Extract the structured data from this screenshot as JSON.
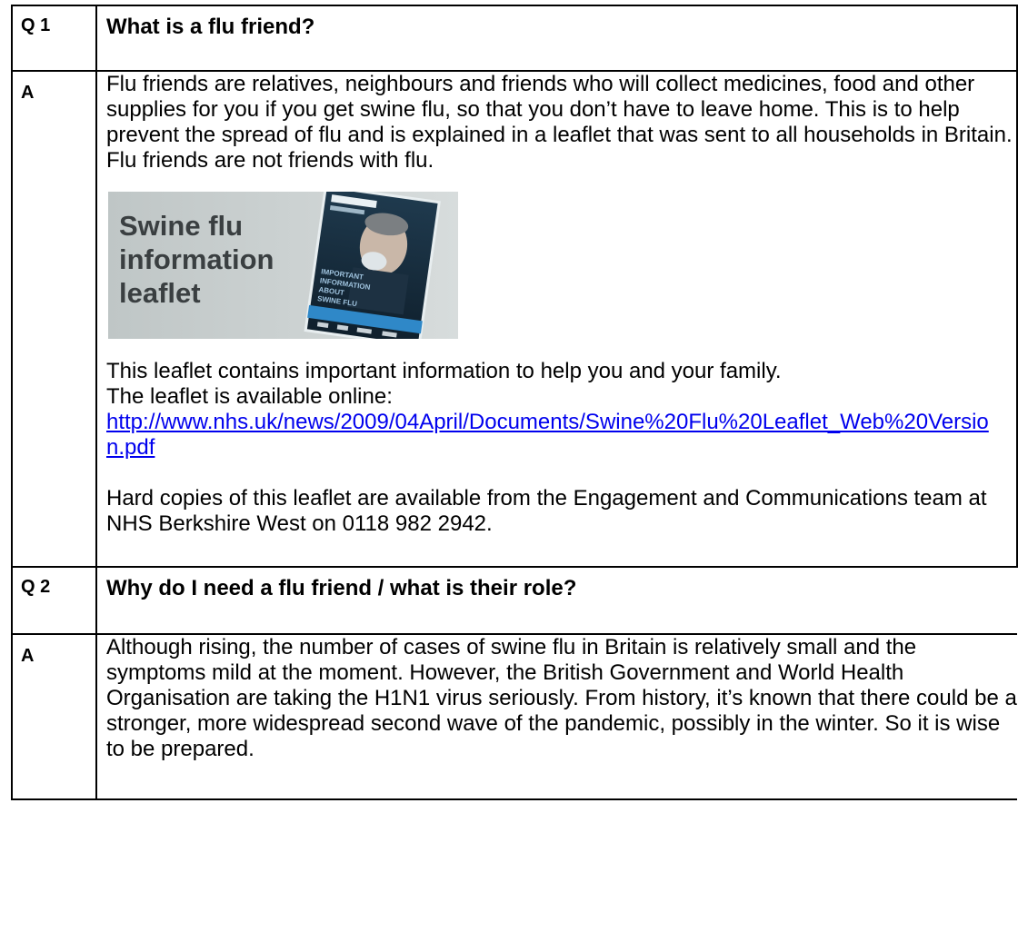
{
  "questions": [
    {
      "q_label": "Q 1",
      "question": "What is a flu friend?",
      "a_label": "A",
      "answer_intro": "Flu friends are relatives, neighbours and friends who will collect medicines, food and other supplies for you if you get swine flu, so that you don’t have to leave home. This is to help prevent the spread of flu and is explained in a leaflet that was sent to all households in Britain. Flu friends are not friends with flu.",
      "image": {
        "line1": "Swine flu",
        "line2": "information",
        "line3": "leaflet",
        "cover_text1": "IMPORTANT",
        "cover_text2": "INFORMATION",
        "cover_text3": "ABOUT",
        "cover_text4": "SWINE FLU"
      },
      "answer_line1": "This leaflet contains important information to help you and your family.",
      "answer_line2": "The leaflet is available online:",
      "link": "http://www.nhs.uk/news/2009/04April/Documents/Swine%20Flu%20Leaflet_Web%20Version.pdf",
      "answer_footer": "Hard copies of this leaflet are available from the Engagement and Communications team at NHS Berkshire West on 0118 982 2942."
    },
    {
      "q_label": "Q 2",
      "question": "Why do I need a flu friend / what is their role?",
      "a_label": "A",
      "answer_intro": "Although rising, the number of cases of swine flu in Britain is relatively small and the symptoms mild at the moment. However, the British Government and World Health Organisation are taking the H1N1 virus seriously.  From history, it’s known that there could be a stronger, more widespread second wave of the pandemic, possibly in the winter. So it is wise to be prepared."
    }
  ],
  "colors": {
    "link": "#0000ee",
    "border": "#000000",
    "banner_bg": "#c9cfcf",
    "banner_text": "#3a3f41"
  }
}
